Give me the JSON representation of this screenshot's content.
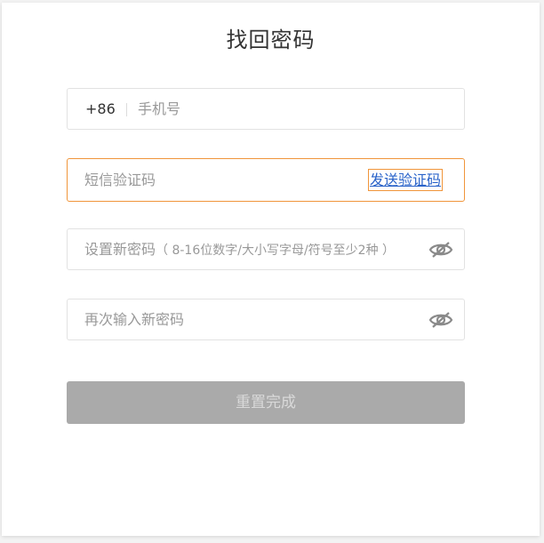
{
  "title": "找回密码",
  "phone": {
    "prefix": "+86",
    "placeholder": "手机号"
  },
  "code": {
    "placeholder": "短信验证码",
    "send_label": "发送验证码"
  },
  "new_password": {
    "placeholder": "设置新密码",
    "hint": "（ 8-16位数字/大小写字母/符号至少2种 ）",
    "toggle_icon": "eye-off-icon"
  },
  "confirm_password": {
    "placeholder": "再次输入新密码",
    "toggle_icon": "eye-off-icon"
  },
  "submit_label": "重置完成",
  "colors": {
    "accent_border": "#f0953a",
    "link": "#2a63c9",
    "submit_disabled_bg": "#aaaaaa"
  }
}
